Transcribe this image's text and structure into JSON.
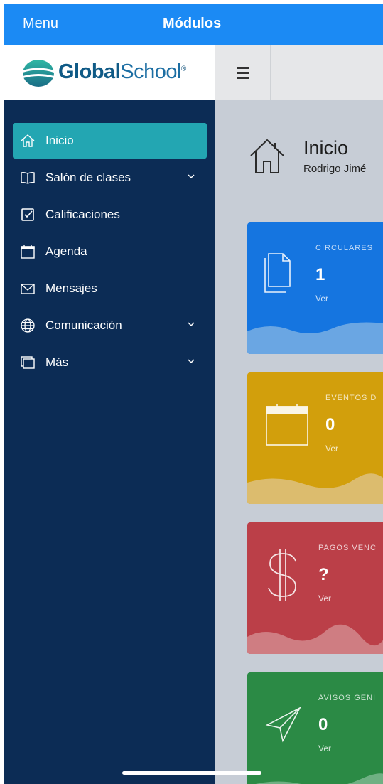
{
  "topbar": {
    "menu": "Menu",
    "title": "Módulos"
  },
  "brand": {
    "bold": "Global",
    "rest": "School",
    "mark": "®"
  },
  "sidebar": {
    "items": [
      {
        "label": "Inicio",
        "icon": "home-icon",
        "active": true
      },
      {
        "label": "Salón de clases",
        "icon": "book-icon",
        "has_chevron": true
      },
      {
        "label": "Calificaciones",
        "icon": "checkbox-icon"
      },
      {
        "label": "Agenda",
        "icon": "calendar-icon"
      },
      {
        "label": "Mensajes",
        "icon": "envelope-icon"
      },
      {
        "label": "Comunicación",
        "icon": "globe-icon",
        "has_chevron": true
      },
      {
        "label": "Más",
        "icon": "windows-icon",
        "has_chevron": true
      }
    ]
  },
  "main": {
    "title": "Inicio",
    "subtitle": "Rodrigo Jimé"
  },
  "cards": [
    {
      "title": "CIRCULARES",
      "value": "1",
      "link": "Ver",
      "color": "#1575e0",
      "icon": "document-icon"
    },
    {
      "title": "EVENTOS D",
      "value": "0",
      "link": "Ver",
      "color": "#d29f0c",
      "icon": "calendar-icon"
    },
    {
      "title": "PAGOS VENC",
      "value": "?",
      "link": "Ver",
      "color": "#bb3f48",
      "icon": "dollar-icon"
    },
    {
      "title": "AVISOS GENI",
      "value": "0",
      "link": "Ver",
      "color": "#2b8a45",
      "icon": "paper-plane-icon"
    }
  ],
  "colors": {
    "topbar": "#1b8af4",
    "sidebar": "#0c2c55",
    "active": "#23a6b2"
  }
}
